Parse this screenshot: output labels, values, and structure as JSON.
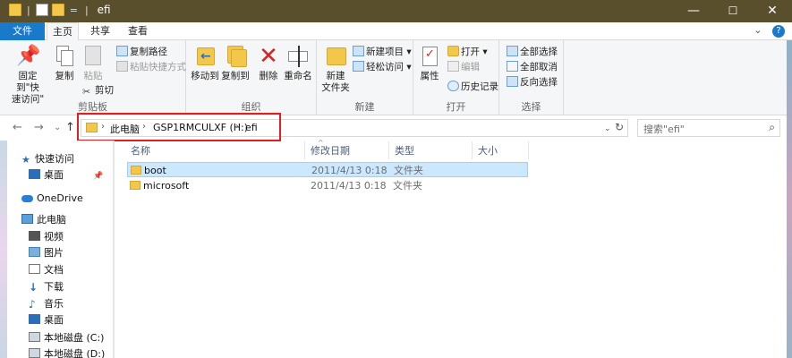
{
  "window": {
    "title": "efi",
    "qat_separator": "|",
    "qat_dropdown": "=",
    "controls": {
      "minimize": "—",
      "maximize": "☐",
      "close": "✕"
    }
  },
  "tabs": {
    "file": "文件",
    "home": "主页",
    "share": "共享",
    "view": "查看"
  },
  "ribbon_right": {
    "collapse": "⌄",
    "help": "?"
  },
  "ribbon": {
    "clipboard": {
      "label": "剪贴板",
      "pin": "固定到\"快\n速访问\"",
      "copy": "复制",
      "paste": "粘贴",
      "copy_path": "复制路径",
      "paste_shortcut": "粘贴快捷方式",
      "cut": "剪切"
    },
    "organize": {
      "label": "组织",
      "move_to": "移动到",
      "copy_to": "复制到",
      "delete": "删除",
      "rename": "重命名"
    },
    "new": {
      "label": "新建",
      "new_folder": "新建\n文件夹",
      "new_item": "新建项目 ▾",
      "easy_access": "轻松访问 ▾"
    },
    "open": {
      "label": "打开",
      "properties": "属性",
      "open": "打开 ▾",
      "edit": "编辑",
      "history": "历史记录"
    },
    "select": {
      "label": "选择",
      "select_all": "全部选择",
      "select_none": "全部取消",
      "invert": "反向选择"
    }
  },
  "address": {
    "back": "←",
    "forward": "→",
    "recent": "⌄",
    "up": "↑",
    "crumbs": [
      "此电脑",
      "GSP1RMCULXF (H:)",
      "efi"
    ],
    "crumb_sep": "›",
    "dropdown": "⌄",
    "refresh": "↻",
    "search_placeholder": "搜索\"efi\"",
    "search_icon": "⌕"
  },
  "nav": {
    "quick_access": "快速访问",
    "desktop_pinned": "桌面",
    "onedrive": "OneDrive",
    "this_pc": "此电脑",
    "videos": "视频",
    "pictures": "图片",
    "documents": "文档",
    "downloads": "下载",
    "music": "音乐",
    "desktop": "桌面",
    "local_c": "本地磁盘 (C:)",
    "local_d": "本地磁盘 (D:)"
  },
  "list": {
    "headers": {
      "name": "名称",
      "modified": "修改日期",
      "type": "类型",
      "size": "大小"
    },
    "sort_indicator": "^",
    "rows": [
      {
        "name": "boot",
        "modified": "2011/4/13 0:18",
        "type": "文件夹"
      },
      {
        "name": "microsoft",
        "modified": "2011/4/13 0:18",
        "type": "文件夹"
      }
    ]
  }
}
